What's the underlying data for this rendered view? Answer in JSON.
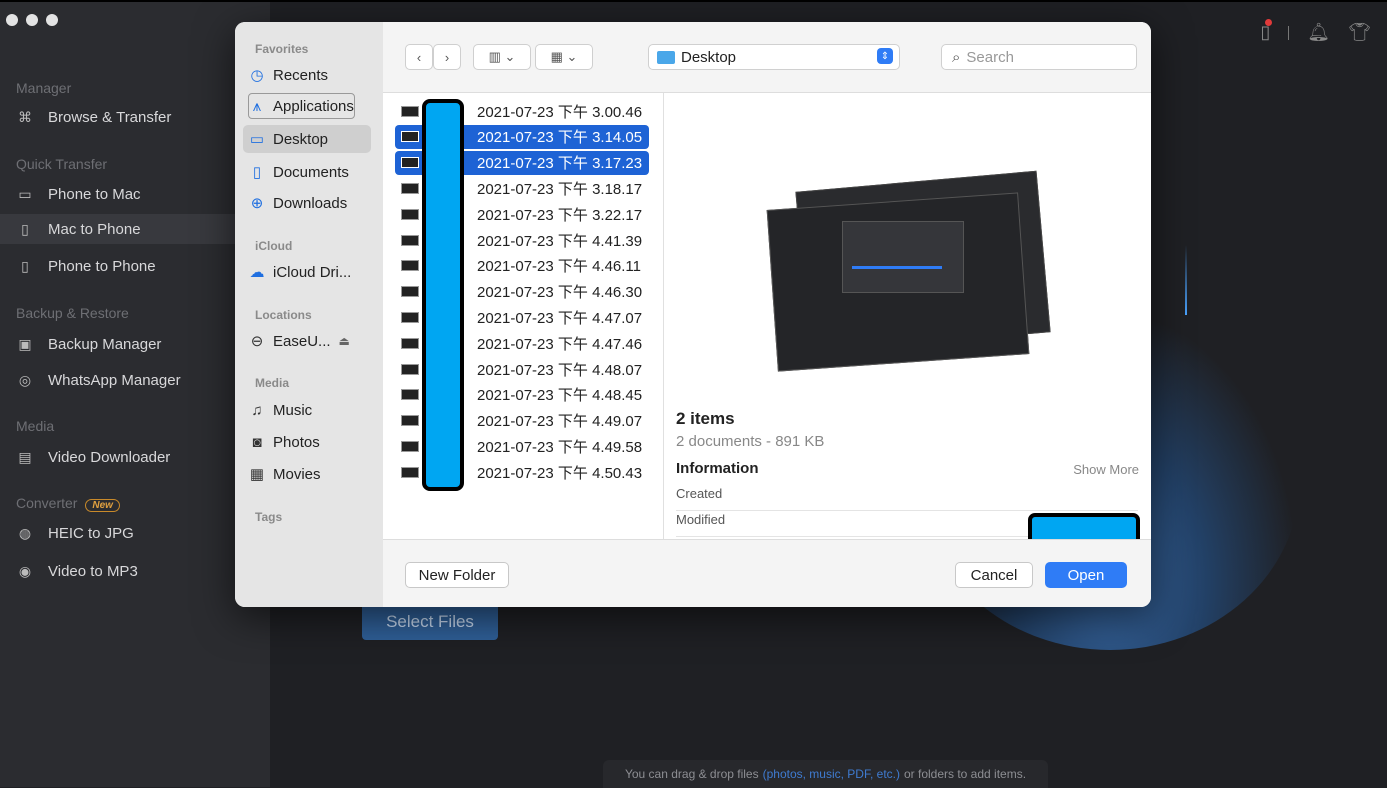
{
  "app": {
    "sidebar": {
      "sections": [
        {
          "title": "Manager",
          "items": [
            {
              "label": "Browse & Transfer",
              "icon": "grid-icon"
            }
          ]
        },
        {
          "title": "Quick Transfer",
          "items": [
            {
              "label": "Phone to Mac",
              "icon": "monitor-icon"
            },
            {
              "label": "Mac to Phone",
              "icon": "phone-icon"
            },
            {
              "label": "Phone to Phone",
              "icon": "phones-icon"
            }
          ]
        },
        {
          "title": "Backup & Restore",
          "items": [
            {
              "label": "Backup Manager",
              "icon": "backup-icon"
            },
            {
              "label": "WhatsApp Manager",
              "icon": "whatsapp-icon"
            }
          ]
        },
        {
          "title": "Media",
          "items": [
            {
              "label": "Video Downloader",
              "icon": "download-video-icon"
            }
          ]
        },
        {
          "title": "Converter",
          "badge": "New",
          "items": [
            {
              "label": "HEIC to JPG",
              "icon": "heic-icon"
            },
            {
              "label": "Video to MP3",
              "icon": "mp3-icon"
            }
          ]
        }
      ]
    },
    "select_files_label": "Select Files",
    "drop_hint": {
      "prefix": "You can drag & drop files",
      "highlight": "(photos, music, PDF, etc.)",
      "suffix": "or folders to add items."
    }
  },
  "dialog": {
    "sidebar": {
      "favorites_title": "Favorites",
      "favorites": [
        "Recents",
        "Applications",
        "Desktop",
        "Documents",
        "Downloads"
      ],
      "icloud_title": "iCloud",
      "icloud": [
        "iCloud Dri..."
      ],
      "locations_title": "Locations",
      "locations": [
        "EaseU..."
      ],
      "media_title": "Media",
      "media": [
        "Music",
        "Photos",
        "Movies"
      ],
      "tags_title": "Tags"
    },
    "toolbar": {
      "location": "Desktop",
      "search_placeholder": "Search"
    },
    "files": [
      {
        "name": "2021-07-23 下午 3.00.46",
        "selected": false
      },
      {
        "name": "2021-07-23 下午 3.14.05",
        "selected": true
      },
      {
        "name": "2021-07-23 下午 3.17.23",
        "selected": true
      },
      {
        "name": "2021-07-23 下午 3.18.17",
        "selected": false
      },
      {
        "name": "2021-07-23 下午 3.22.17",
        "selected": false
      },
      {
        "name": "2021-07-23 下午 4.41.39",
        "selected": false
      },
      {
        "name": "2021-07-23 下午 4.46.11",
        "selected": false
      },
      {
        "name": "2021-07-23 下午 4.46.30",
        "selected": false
      },
      {
        "name": "2021-07-23 下午 4.47.07",
        "selected": false
      },
      {
        "name": "2021-07-23 下午 4.47.46",
        "selected": false
      },
      {
        "name": "2021-07-23 下午 4.48.07",
        "selected": false
      },
      {
        "name": "2021-07-23 下午 4.48.45",
        "selected": false
      },
      {
        "name": "2021-07-23 下午 4.49.07",
        "selected": false
      },
      {
        "name": "2021-07-23 下午 4.49.58",
        "selected": false
      },
      {
        "name": "2021-07-23 下午 4.50.43",
        "selected": false
      }
    ],
    "preview": {
      "count_label": "2 items",
      "summary": "2 documents - 891 KB",
      "info_title": "Information",
      "show_more": "Show More",
      "created_label": "Created",
      "modified_label": "Modified"
    },
    "footer": {
      "new_folder": "New Folder",
      "cancel": "Cancel",
      "open": "Open"
    }
  }
}
